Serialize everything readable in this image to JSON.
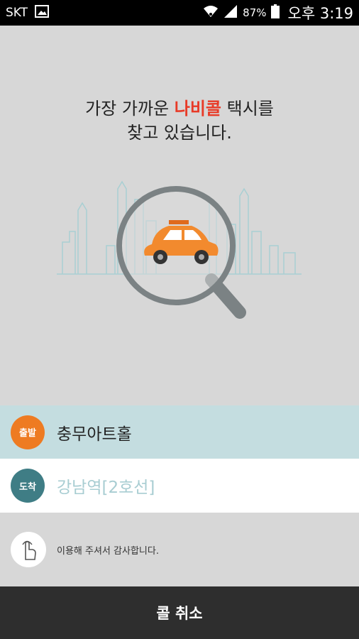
{
  "status_bar": {
    "carrier": "SKT",
    "battery": "87%",
    "time": "오후 3:19"
  },
  "headline": {
    "line1_prefix": "가장 가까운 ",
    "brand": "나비콜",
    "line1_suffix": " 택시를",
    "line2": "찾고 있습니다."
  },
  "route": {
    "depart_badge": "출발",
    "depart_place": "충무아트홀",
    "arrive_badge": "도착",
    "arrive_place": "강남역[2호선]"
  },
  "notice": "이용해 주셔서 감사합니다.",
  "cancel_button": "콜 취소",
  "colors": {
    "brand": "#e83a27",
    "depart": "#ee7b22",
    "arrive": "#3f7d85",
    "taxi": "#f28a2e"
  }
}
